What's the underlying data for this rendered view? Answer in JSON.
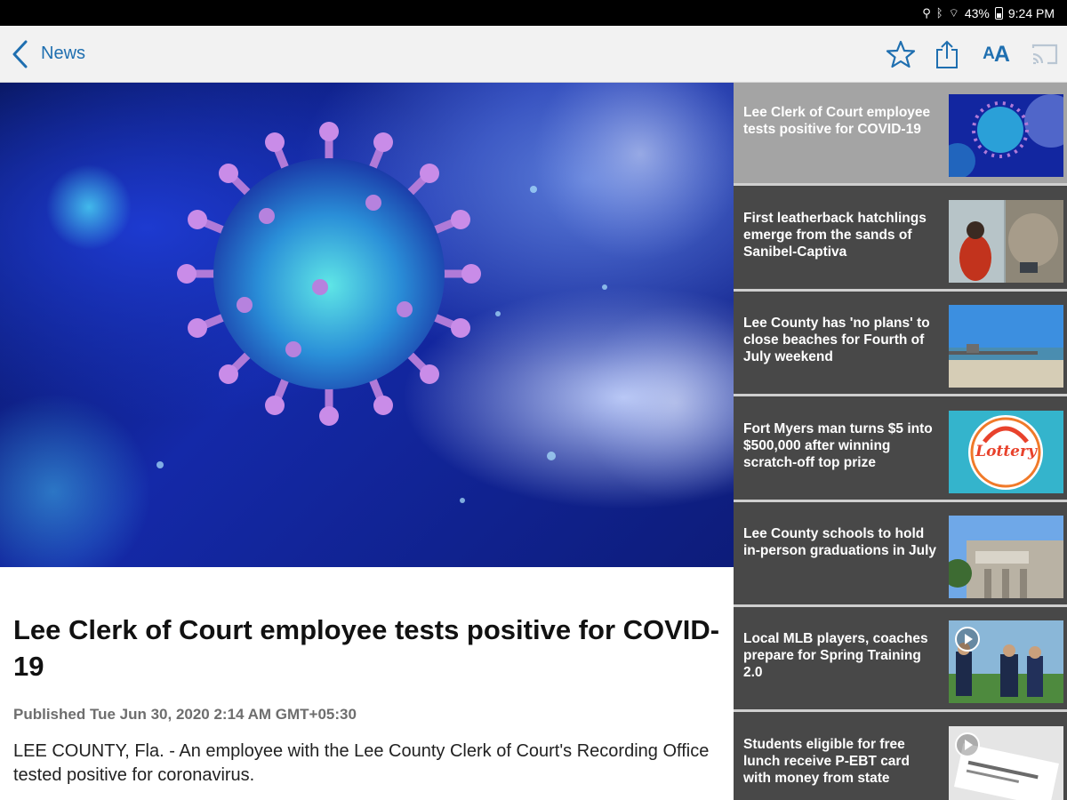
{
  "status_bar": {
    "battery": "43%",
    "time": "9:24 PM",
    "icons": [
      "location-icon",
      "bluetooth-icon",
      "wifi-icon",
      "battery-icon"
    ]
  },
  "app_bar": {
    "back_label": "News",
    "text_size_label_large": "A",
    "text_size_label_small": "A",
    "icons": [
      "back-chevron-icon",
      "star-icon",
      "share-icon",
      "text-size-icon",
      "cast-icon"
    ],
    "accent_color": "#1f6fb0"
  },
  "article": {
    "headline": "Lee Clerk of Court employee tests positive for COVID-19",
    "published": "Published Tue Jun 30, 2020 2:14 AM GMT+05:30",
    "body": "LEE COUNTY, Fla. - An employee with the Lee County Clerk of Court's Recording Office tested positive for coronavirus."
  },
  "stories": [
    {
      "title": "Lee Clerk of Court employee tests positive for COVID-19",
      "active": true,
      "thumb": "virus"
    },
    {
      "title": "First leatherback hatchlings emerge from the sands of Sanibel-Captiva",
      "active": false,
      "thumb": "beach-people"
    },
    {
      "title": "Lee County has 'no plans' to close beaches for Fourth of July weekend",
      "active": false,
      "thumb": "pier"
    },
    {
      "title": "Fort Myers man turns $5 into $500,000 after winning scratch-off top prize",
      "active": false,
      "thumb": "lottery",
      "thumb_text": "Lottery"
    },
    {
      "title": "Lee County schools to hold in-person graduations in July",
      "active": false,
      "thumb": "school"
    },
    {
      "title": "Local MLB players, coaches prepare for Spring Training 2.0",
      "active": false,
      "thumb": "baseball",
      "video": true
    },
    {
      "title": "Students eligible for free lunch receive P-EBT card with money from state",
      "active": false,
      "thumb": "card",
      "video": true
    }
  ]
}
